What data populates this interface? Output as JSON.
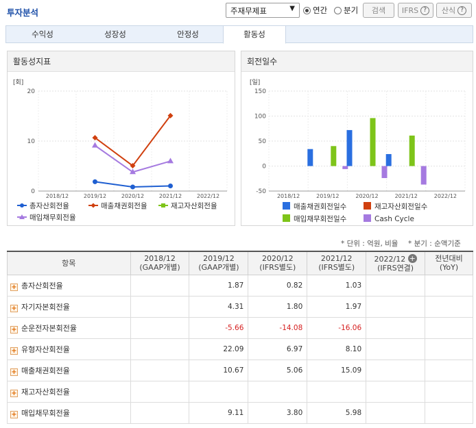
{
  "header": {
    "title": "투자분석",
    "select_value": "주재무제표",
    "radio_annual": "연간",
    "radio_quarter": "분기",
    "search_button": "검색",
    "ifrs_button": "IFRS",
    "formula_button": "산식",
    "help_icon": "?"
  },
  "tabs": [
    "수익성",
    "성장성",
    "안정성",
    "활동성"
  ],
  "left_panel": {
    "title": "활동성지표"
  },
  "right_panel": {
    "title": "회전일수"
  },
  "units_note": "* 단위 : 억원, 비율",
  "quarter_note": "* 분기 : 순액기준",
  "chart_data": [
    {
      "type": "line",
      "title": "활동성지표",
      "ylabel": "[회]",
      "ylim": [
        0,
        20
      ],
      "yticks": [
        0,
        10,
        20
      ],
      "categories": [
        "2018/12",
        "2019/12",
        "2020/12",
        "2021/12",
        "2022/12"
      ],
      "series": [
        {
          "name": "총자산회전율",
          "color": "#1f5fd1",
          "marker": "circle",
          "values": [
            null,
            1.87,
            0.82,
            1.03,
            null
          ]
        },
        {
          "name": "매출채권회전율",
          "color": "#d0400f",
          "marker": "diamond",
          "values": [
            null,
            10.67,
            5.06,
            15.09,
            null
          ]
        },
        {
          "name": "재고자산회전율",
          "color": "#7ec41a",
          "marker": "square",
          "values": [
            null,
            null,
            null,
            null,
            null
          ]
        },
        {
          "name": "매입채무회전율",
          "color": "#a57ae0",
          "marker": "triangle",
          "values": [
            null,
            9.11,
            3.8,
            5.98,
            null
          ]
        }
      ]
    },
    {
      "type": "bar",
      "title": "회전일수",
      "ylabel": "[일]",
      "ylim": [
        -50,
        150
      ],
      "yticks": [
        -50,
        0,
        50,
        100,
        150
      ],
      "categories": [
        "2018/12",
        "2019/12",
        "2020/12",
        "2021/12",
        "2022/12"
      ],
      "series": [
        {
          "name": "매출채권회전일수",
          "color": "#2a6fe0",
          "values": [
            null,
            34,
            72,
            24,
            null
          ]
        },
        {
          "name": "재고자산회전일수",
          "color": "#d0400f",
          "values": [
            null,
            null,
            null,
            null,
            null
          ]
        },
        {
          "name": "매입채무회전일수",
          "color": "#7ec41a",
          "values": [
            null,
            40,
            96,
            61,
            null
          ]
        },
        {
          "name": "Cash Cycle",
          "color": "#a57ae0",
          "values": [
            null,
            -6,
            -24,
            -37,
            null
          ]
        }
      ]
    }
  ],
  "table": {
    "headers": [
      {
        "l1": "항목",
        "l2": ""
      },
      {
        "l1": "2018/12",
        "l2": "(GAAP개별)"
      },
      {
        "l1": "2019/12",
        "l2": "(GAAP개별)"
      },
      {
        "l1": "2020/12",
        "l2": "(IFRS별도)"
      },
      {
        "l1": "2021/12",
        "l2": "(IFRS별도)"
      },
      {
        "l1": "2022/12",
        "l2": "(IFRS연결)"
      },
      {
        "l1": "전년대비",
        "l2": "(YoY)"
      }
    ],
    "rows": [
      {
        "name": "총자산회전율",
        "values": [
          "",
          "1.87",
          "0.82",
          "1.03",
          "",
          ""
        ]
      },
      {
        "name": "자기자본회전율",
        "values": [
          "",
          "4.31",
          "1.80",
          "1.97",
          "",
          ""
        ]
      },
      {
        "name": "순운전자본회전율",
        "values": [
          "",
          "-5.66",
          "-14.08",
          "-16.06",
          "",
          ""
        ]
      },
      {
        "name": "유형자산회전율",
        "values": [
          "",
          "22.09",
          "6.97",
          "8.10",
          "",
          ""
        ]
      },
      {
        "name": "매출채권회전율",
        "values": [
          "",
          "10.67",
          "5.06",
          "15.09",
          "",
          ""
        ]
      },
      {
        "name": "재고자산회전율",
        "values": [
          "",
          "",
          "",
          "",
          "",
          ""
        ]
      },
      {
        "name": "매입채무회전율",
        "values": [
          "",
          "9.11",
          "3.80",
          "5.98",
          "",
          ""
        ]
      }
    ]
  }
}
